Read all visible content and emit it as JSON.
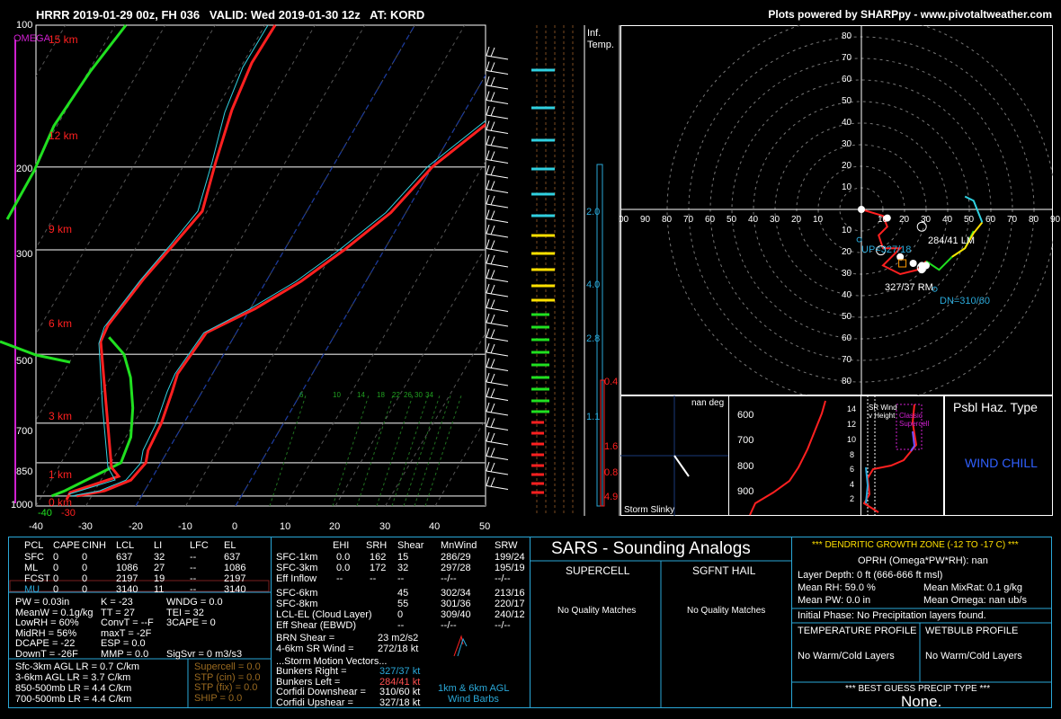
{
  "header": {
    "title": "HRRR 2019-01-29 00z, FH 036   VALID: Wed 2019-01-30 12z   AT: KORD",
    "credit": "Plots powered by SHARPpy - www.pivotaltweather.com"
  },
  "skewt": {
    "omega_label": "OMEGA",
    "pressure_ticks": [
      "100",
      "200",
      "300",
      "500",
      "700",
      "850",
      "1000"
    ],
    "height_labels": [
      "15 km",
      "12 km",
      "9 km",
      "6 km",
      "3 km",
      "1 km",
      "0 km"
    ],
    "temp_ticks": [
      "-40",
      "-30",
      "-20",
      "-10",
      "0",
      "10",
      "20",
      "30",
      "40",
      "50"
    ],
    "low_labels": [
      "-40",
      "-30"
    ],
    "mixing_ratio_labels": [
      "6",
      "10",
      "14",
      "18",
      "22",
      "26",
      "30",
      "34"
    ]
  },
  "inferred_temp": {
    "title_line1": "Inf.",
    "title_line2": "Temp.",
    "values": [
      "2.0",
      "4.0",
      "2.8",
      "1.1",
      "0.4",
      "1.6",
      "0.8",
      "4.9"
    ]
  },
  "hodograph": {
    "ring_labels": [
      "80",
      "70",
      "60",
      "50",
      "40",
      "30",
      "20",
      "10"
    ],
    "axis_labels": [
      "00",
      "90",
      "80",
      "70",
      "60",
      "50",
      "40",
      "30",
      "20",
      "10",
      "10",
      "20",
      "30",
      "40",
      "50",
      "60",
      "70",
      "80",
      "90",
      "1"
    ],
    "lm_label": "284/41 LM",
    "rm_label": "327/37 RM",
    "up_label": "UP=327/18",
    "dn_label": "DN=310/60",
    "point_labels": [
      "0",
      "1",
      "3",
      "3",
      "6",
      "9"
    ]
  },
  "storm_slinky": {
    "label": "Storm Slinky",
    "deg_label": "nan deg"
  },
  "theta_panel": {
    "ticks": [
      "600",
      "700",
      "800",
      "900"
    ]
  },
  "wind_height": {
    "ticks": [
      "14",
      "12",
      "10",
      "8",
      "6",
      "4",
      "2"
    ],
    "sr_label": "SR Wind v Height",
    "supercell_label": "Classic Supercell"
  },
  "possible_hazard": {
    "title": "Psbl Haz. Type",
    "value": "WIND CHILL"
  },
  "parcel_table": {
    "headers": [
      "PCL",
      "CAPE",
      "CINH",
      "LCL",
      "LI",
      "LFC",
      "EL"
    ],
    "rows": [
      [
        "SFC",
        "0",
        "0",
        "637",
        "32",
        "--",
        "637"
      ],
      [
        "ML",
        "0",
        "0",
        "1086",
        "27",
        "--",
        "1086"
      ],
      [
        "FCST",
        "0",
        "0",
        "2197",
        "19",
        "--",
        "2197"
      ],
      [
        "MU",
        "0",
        "0",
        "3140",
        "11",
        "--",
        "3140"
      ]
    ]
  },
  "indices": {
    "col1": [
      "PW = 0.03in",
      "MeanW = 0.1g/kg",
      "LowRH = 60%",
      "MidRH = 56%",
      "DCAPE = -22",
      "DownT = -26F"
    ],
    "col2": [
      "K = -23",
      "TT = 27",
      "ConvT = --F",
      "maxT = -2F",
      "ESP = 0.0",
      "MMP = 0.0"
    ],
    "col3": [
      "WNDG = 0.0",
      "TEI = 32",
      "3CAPE = 0",
      "",
      "",
      "SigSvr = 0 m3/s3"
    ]
  },
  "lapse_rates": [
    "Sfc-3km AGL LR = 0.7 C/km",
    "3-6km AGL LR = 3.7 C/km",
    "850-500mb LR = 4.4 C/km",
    "700-500mb LR = 4.4 C/km"
  ],
  "composite": [
    "Supercell = 0.0",
    "STP (cin) = 0.0",
    "STP (fix) = 0.0",
    "SHIP = 0.0"
  ],
  "kinematics": {
    "headers": [
      "EHI",
      "SRH",
      "Shear",
      "MnWind",
      "SRW"
    ],
    "rows": [
      [
        "SFC-1km",
        "0.0",
        "162",
        "15",
        "286/29",
        "199/24"
      ],
      [
        "SFC-3km",
        "0.0",
        "172",
        "32",
        "297/28",
        "195/19"
      ],
      [
        "Eff Inflow",
        "--",
        "--",
        "--",
        "--/--",
        "--/--"
      ],
      [
        "SFC-6km",
        "",
        "",
        "45",
        "302/34",
        "213/16"
      ],
      [
        "SFC-8km",
        "",
        "",
        "55",
        "301/36",
        "220/17"
      ],
      [
        "LCL-EL (Cloud Layer)",
        "",
        "",
        "0",
        "309/40",
        "240/12"
      ],
      [
        "Eff Shear (EBWD)",
        "",
        "",
        "--",
        "--/--",
        "--/--"
      ]
    ],
    "brn_shear": "BRN Shear =",
    "brn_value": "23 m2/s2",
    "sr_wind": "4-6km SR Wind =",
    "sr_value": "272/18 kt",
    "motion_title": "...Storm Motion Vectors...",
    "motions": [
      [
        "Bunkers Right =",
        "327/37 kt"
      ],
      [
        "Bunkers Left =",
        "284/41 kt"
      ],
      [
        "Corfidi Downshear =",
        "310/60 kt"
      ],
      [
        "Corfidi Upshear =",
        "327/18 kt"
      ]
    ],
    "barbs_label1": "1km & 6km AGL",
    "barbs_label2": "Wind Barbs"
  },
  "sars": {
    "title": "SARS - Sounding Analogs",
    "supercell": "SUPERCELL",
    "hail": "SGFNT HAIL",
    "supercell_result": "No Quality Matches",
    "hail_result": "No Quality Matches"
  },
  "dgz": {
    "title": "*** DENDRITIC GROWTH ZONE (-12 TO -17 C) ***",
    "oprh": "OPRH (Omega*PW*RH): nan",
    "layer_depth": "Layer Depth: 0 ft (666-666 ft msl)",
    "mean_rh": "Mean RH: 59.0 %",
    "mean_mixrat": "Mean MixRat: 0.1 g/kg",
    "mean_pw": "Mean PW: 0.0 in",
    "mean_omega": "Mean Omega: nan ub/s",
    "initial_phase": "Initial Phase:  No Precipitation layers found.",
    "temp_profile": "TEMPERATURE PROFILE",
    "wetbulb_profile": "WETBULB PROFILE",
    "temp_result": "No Warm/Cold Layers",
    "wetbulb_result": "No Warm/Cold Layers",
    "precip_title": "*** BEST GUESS PRECIP TYPE ***",
    "precip_value": "None."
  },
  "chart_data": [
    {
      "type": "line",
      "xlabel": "",
      "ylabel": "",
      "xlim": [
        -40,
        50
      ],
      "ylim": [
        1000,
        100
      ],
      "series": [
        {
          "points": [
            [
              -33,
              1000
            ],
            [
              -28,
              975
            ],
            [
              -24,
              925
            ],
            [
              -23,
              850
            ],
            [
              -24,
              800
            ],
            [
              -24.5,
              700
            ],
            [
              -26,
              600
            ],
            [
              -27,
              550
            ],
            [
              -26,
              450
            ],
            [
              -19,
              400
            ],
            [
              -13,
              350
            ],
            [
              -8,
              300
            ],
            [
              -3,
              250
            ],
            [
              0,
              200
            ],
            [
              8,
              150
            ],
            [
              15,
              100
            ]
          ],
          "color": "#ff2020"
        },
        {
          "points": [
            [
              -34,
              1000
            ],
            [
              -29,
              975
            ],
            [
              -25,
              925
            ],
            [
              -24,
              850
            ],
            [
              -25,
              800
            ],
            [
              -25.5,
              700
            ],
            [
              -27,
              600
            ],
            [
              -27.5,
              550
            ],
            [
              -26.5,
              450
            ],
            [
              -20,
              400
            ],
            [
              -14,
              350
            ],
            [
              -9,
              300
            ],
            [
              -4,
              250
            ],
            [
              -1,
              200
            ],
            [
              7,
              150
            ],
            [
              14,
              100
            ]
          ],
          "color": "#30d0e0"
        },
        {
          "points": [
            [
              -38,
              1000
            ],
            [
              -36,
              975
            ],
            [
              -28,
              850
            ],
            [
              -29,
              750
            ],
            [
              -32,
              650
            ],
            [
              -36,
              560
            ],
            [
              -40,
              500
            ],
            [
              -45,
              460
            ]
          ],
          "color": "#20e020"
        }
      ]
    }
  ]
}
